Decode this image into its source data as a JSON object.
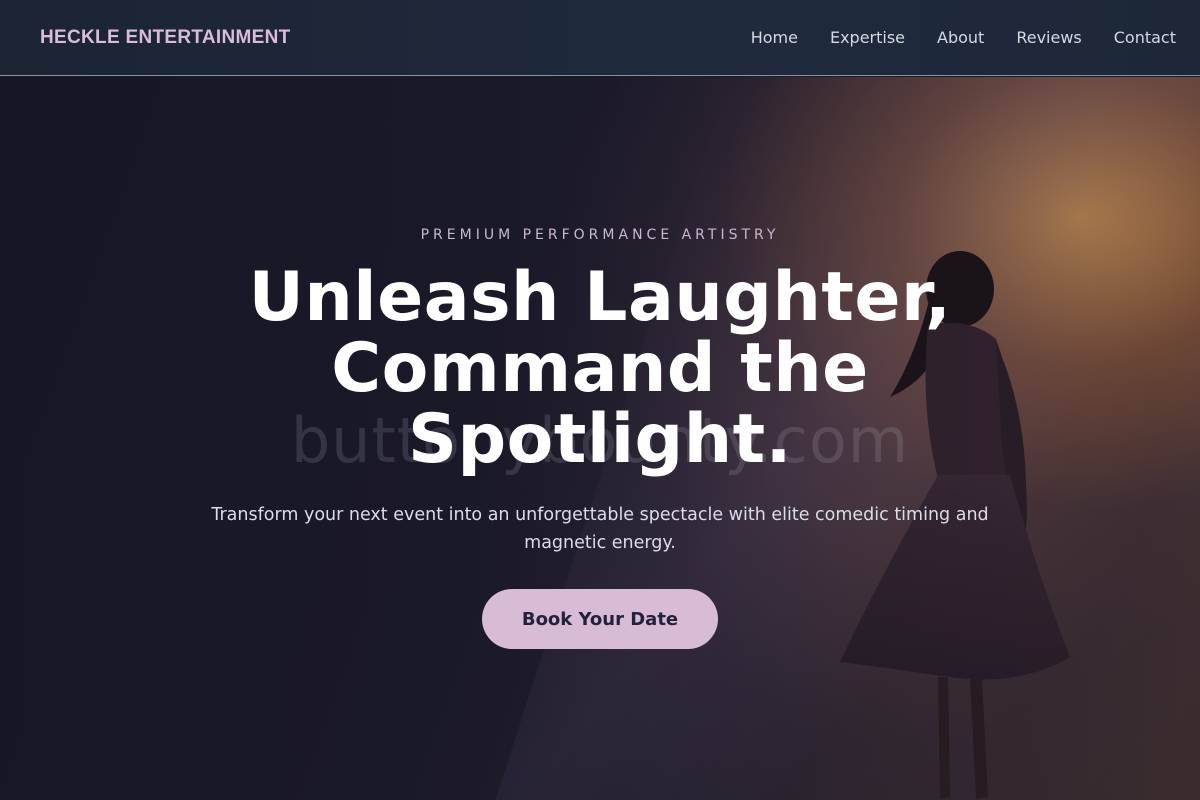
{
  "header": {
    "brand": "HECKLE ENTERTAINMENT",
    "nav": [
      {
        "label": "Home"
      },
      {
        "label": "Expertise"
      },
      {
        "label": "About"
      },
      {
        "label": "Reviews"
      },
      {
        "label": "Contact"
      }
    ]
  },
  "hero": {
    "eyebrow": "PREMIUM PERFORMANCE ARTISTRY",
    "headline": "Unleash Laughter, Command the Spotlight.",
    "subtext": "Transform your next event into an unforgettable spectacle with elite comedic timing and magnetic energy.",
    "cta_label": "Book Your Date",
    "watermark": "buttonybounty.com"
  },
  "colors": {
    "accent": "#d8bcd6",
    "header_bg": "#1f2a3d",
    "hero_bg": "#1a1b27"
  }
}
